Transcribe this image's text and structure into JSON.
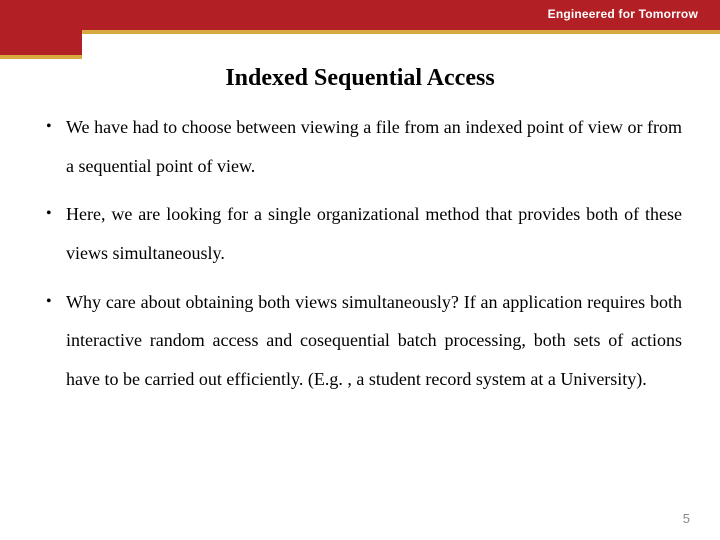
{
  "header": {
    "tagline": "Engineered for Tomorrow"
  },
  "title": "Indexed Sequential Access",
  "bullets": [
    "We have had to choose between viewing a file from an indexed point of view or from a sequential point of view.",
    "Here, we are looking for a single organizational method that provides both of these views simultaneously.",
    "Why care about obtaining both views simultaneously? If an application requires both interactive random access and cosequential batch processing, both sets of actions have to be carried out efficiently. (E.g. , a student record system at a University)."
  ],
  "page_number": "5"
}
